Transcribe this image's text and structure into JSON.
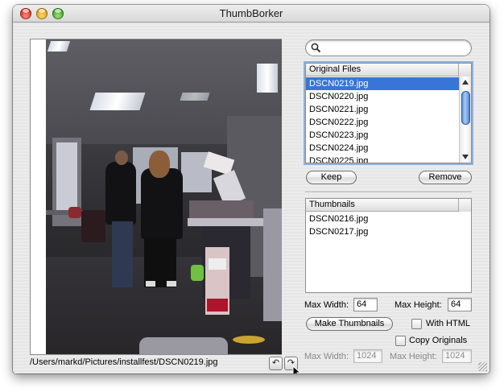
{
  "window": {
    "title": "ThumbBorker"
  },
  "image": {
    "path": "/Users/markd/Pictures/installfest/DSCN0219.jpg"
  },
  "rotate": {
    "left_glyph": "↶",
    "right_glyph": "↷"
  },
  "search": {
    "value": "",
    "placeholder": ""
  },
  "original_files": {
    "header": "Original Files",
    "items": [
      "DSCN0219.jpg",
      "DSCN0220.jpg",
      "DSCN0221.jpg",
      "DSCN0222.jpg",
      "DSCN0223.jpg",
      "DSCN0224.jpg",
      "DSCN0225.jpg"
    ],
    "selected": "DSCN0219.jpg"
  },
  "buttons": {
    "keep": "Keep",
    "remove": "Remove",
    "make_thumbnails": "Make Thumbnails"
  },
  "thumbnails": {
    "header": "Thumbnails",
    "items": [
      "DSCN0216.jpg",
      "DSCN0217.jpg"
    ]
  },
  "thumb_size": {
    "max_width_label": "Max Width:",
    "max_width": "64",
    "max_height_label": "Max Height:",
    "max_height": "64"
  },
  "options": {
    "with_html": "With HTML",
    "copy_originals": "Copy Originals"
  },
  "orig_size": {
    "max_width_label": "Max Width:",
    "max_width": "1024",
    "max_height_label": "Max Height:",
    "max_height": "1024"
  },
  "colors": {
    "selection": "#3875d7",
    "focus_ring": "#8bb1e1"
  }
}
